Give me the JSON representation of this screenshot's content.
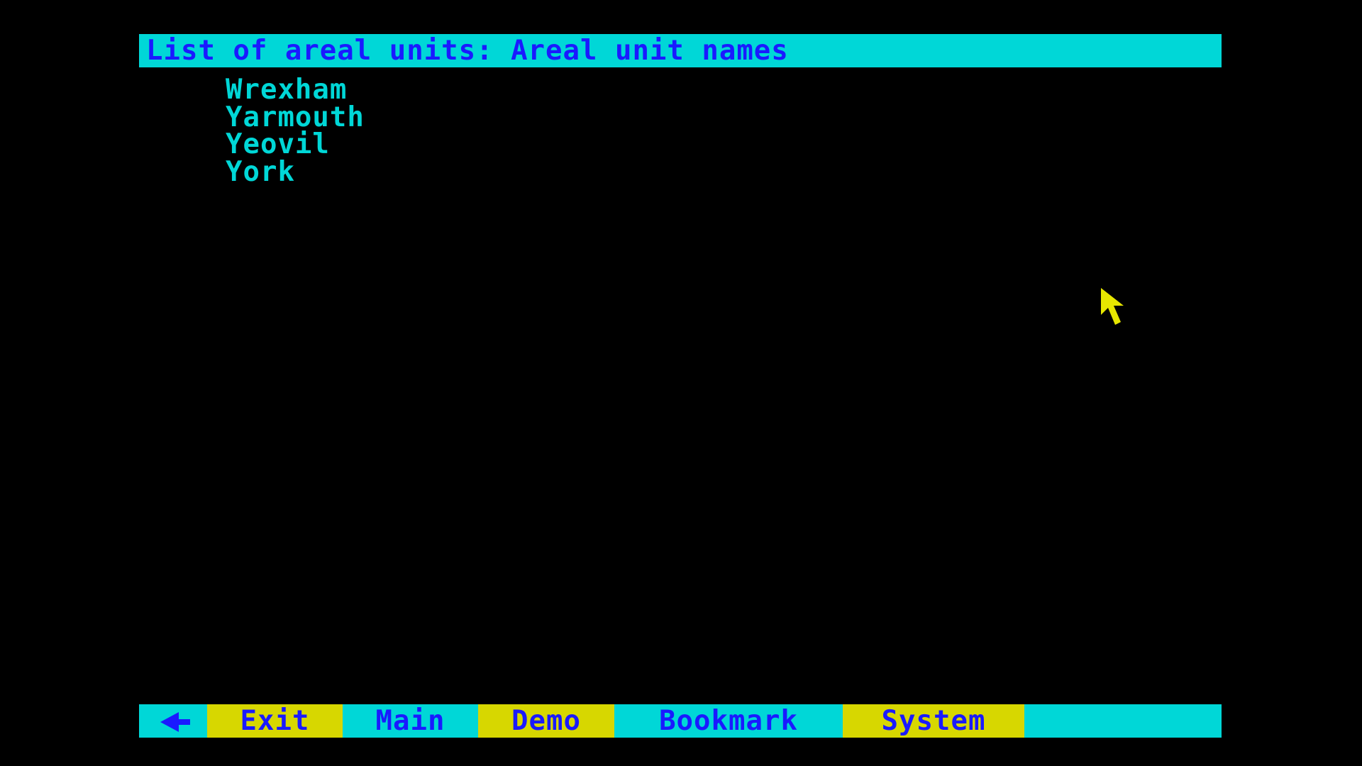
{
  "header": {
    "title": "List of areal units: Areal unit names"
  },
  "units": [
    "Wrexham",
    "Yarmouth",
    "Yeovil",
    "York"
  ],
  "menu": {
    "back_icon": "back-arrow-icon",
    "exit_label": "Exit",
    "main_label": "Main",
    "demo_label": "Demo",
    "bookmark_label": "Bookmark",
    "system_label": "System"
  },
  "colors": {
    "background": "#000000",
    "cyan": "#00d7d7",
    "yellow": "#d7d700",
    "blue_text": "#1a1aff"
  }
}
